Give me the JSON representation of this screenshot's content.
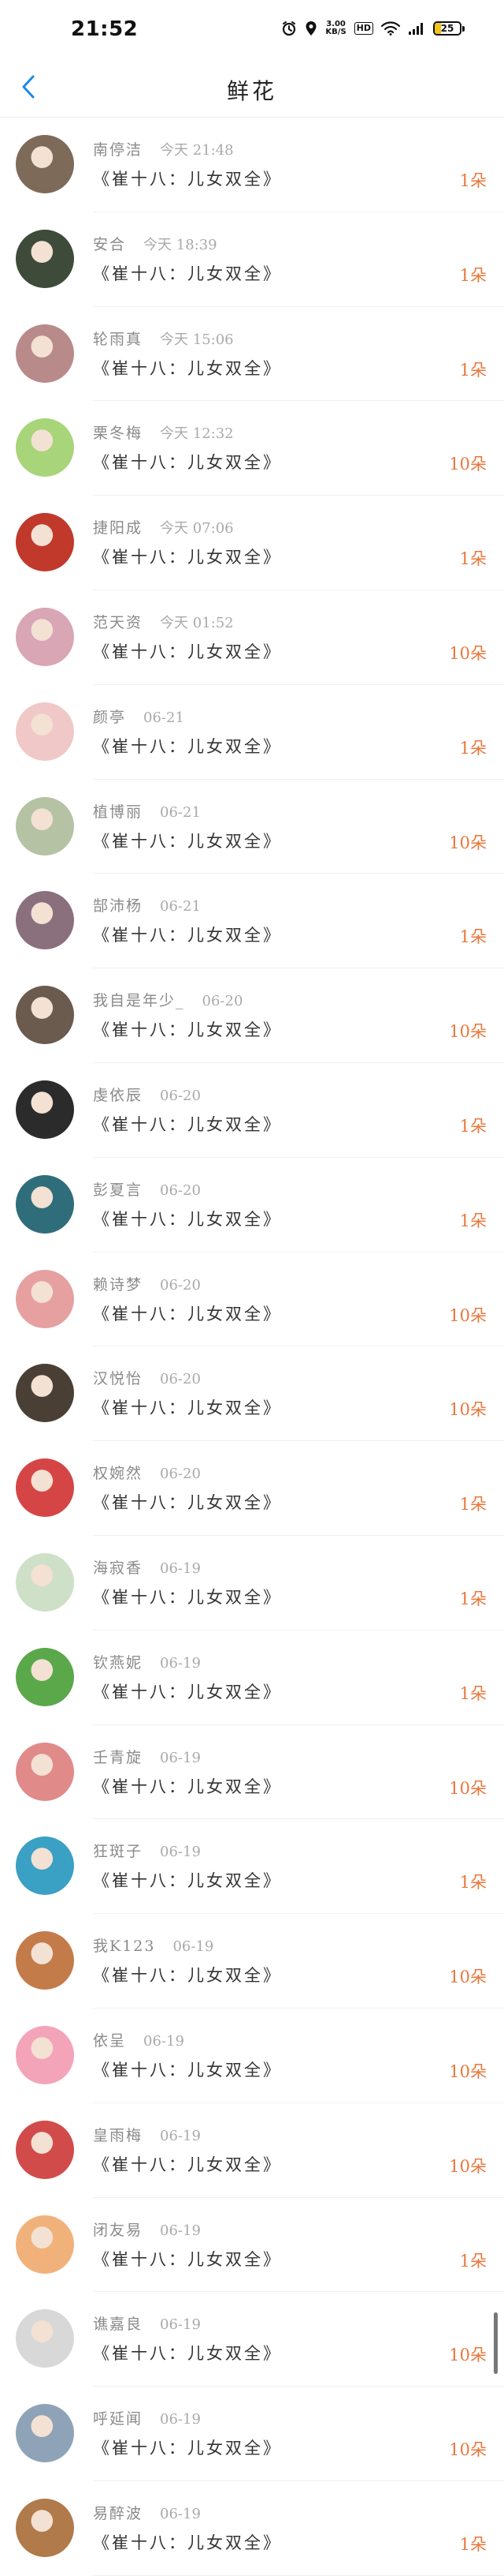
{
  "status_bar": {
    "time": "21:52",
    "net_speed_value": "3.00",
    "net_speed_unit": "KB/S",
    "hd_label": "HD",
    "battery_level": "25",
    "battery_fraction": 0.25,
    "battery_color": "#f2c31a"
  },
  "nav": {
    "back_icon": "chevron-left-icon",
    "title": "鲜花"
  },
  "colors": {
    "accent_blue": "#1e88e5",
    "count_orange": "#e8773b"
  },
  "items": [
    {
      "name": "南停洁",
      "time": "今天 21:48",
      "gift": "《崔十八：儿女双全》",
      "count": "1朵",
      "avatar_color": "#7d6a58"
    },
    {
      "name": "安合",
      "time": "今天 18:39",
      "gift": "《崔十八：儿女双全》",
      "count": "1朵",
      "avatar_color": "#3e4a3a"
    },
    {
      "name": "轮雨真",
      "time": "今天 15:06",
      "gift": "《崔十八：儿女双全》",
      "count": "1朵",
      "avatar_color": "#b98a8a"
    },
    {
      "name": "栗冬梅",
      "time": "今天 12:32",
      "gift": "《崔十八：儿女双全》",
      "count": "10朵",
      "avatar_color": "#a8d47a"
    },
    {
      "name": "捷阳成",
      "time": "今天 07:06",
      "gift": "《崔十八：儿女双全》",
      "count": "1朵",
      "avatar_color": "#c0392b"
    },
    {
      "name": "范天资",
      "time": "今天 01:52",
      "gift": "《崔十八：儿女双全》",
      "count": "10朵",
      "avatar_color": "#d9a6b5"
    },
    {
      "name": "颜亭",
      "time": "06-21",
      "gift": "《崔十八：儿女双全》",
      "count": "1朵",
      "avatar_color": "#f0c8c8"
    },
    {
      "name": "植博丽",
      "time": "06-21",
      "gift": "《崔十八：儿女双全》",
      "count": "10朵",
      "avatar_color": "#b5c2a3"
    },
    {
      "name": "郜沛杨",
      "time": "06-21",
      "gift": "《崔十八：儿女双全》",
      "count": "1朵",
      "avatar_color": "#8a6f7d"
    },
    {
      "name": "我自是年少_",
      "time": "06-20",
      "gift": "《崔十八：儿女双全》",
      "count": "10朵",
      "avatar_color": "#6b5a4e"
    },
    {
      "name": "虔依辰",
      "time": "06-20",
      "gift": "《崔十八：儿女双全》",
      "count": "1朵",
      "avatar_color": "#2b2b2b"
    },
    {
      "name": "彭夏言",
      "time": "06-20",
      "gift": "《崔十八：儿女双全》",
      "count": "1朵",
      "avatar_color": "#2f6d7a"
    },
    {
      "name": "赖诗梦",
      "time": "06-20",
      "gift": "《崔十八：儿女双全》",
      "count": "10朵",
      "avatar_color": "#e6a0a0"
    },
    {
      "name": "汉悦怡",
      "time": "06-20",
      "gift": "《崔十八：儿女双全》",
      "count": "10朵",
      "avatar_color": "#4a3f35"
    },
    {
      "name": "权婉然",
      "time": "06-20",
      "gift": "《崔十八：儿女双全》",
      "count": "1朵",
      "avatar_color": "#d64545"
    },
    {
      "name": "海寂香",
      "time": "06-19",
      "gift": "《崔十八：儿女双全》",
      "count": "1朵",
      "avatar_color": "#cfe0c8"
    },
    {
      "name": "钦燕妮",
      "time": "06-19",
      "gift": "《崔十八：儿女双全》",
      "count": "1朵",
      "avatar_color": "#5aa84a"
    },
    {
      "name": "壬青旋",
      "time": "06-19",
      "gift": "《崔十八：儿女双全》",
      "count": "10朵",
      "avatar_color": "#e08a8a"
    },
    {
      "name": "狂斑子",
      "time": "06-19",
      "gift": "《崔十八：儿女双全》",
      "count": "1朵",
      "avatar_color": "#3aa0c4"
    },
    {
      "name": "我K123",
      "time": "06-19",
      "gift": "《崔十八：儿女双全》",
      "count": "10朵",
      "avatar_color": "#c47b4a"
    },
    {
      "name": "依呈",
      "time": "06-19",
      "gift": "《崔十八：儿女双全》",
      "count": "10朵",
      "avatar_color": "#f4a4b8"
    },
    {
      "name": "皇雨梅",
      "time": "06-19",
      "gift": "《崔十八：儿女双全》",
      "count": "10朵",
      "avatar_color": "#d24b4b"
    },
    {
      "name": "闭友易",
      "time": "06-19",
      "gift": "《崔十八：儿女双全》",
      "count": "1朵",
      "avatar_color": "#f0b27a"
    },
    {
      "name": "谯嘉良",
      "time": "06-19",
      "gift": "《崔十八：儿女双全》",
      "count": "10朵",
      "avatar_color": "#d8d8d8"
    },
    {
      "name": "呼延闻",
      "time": "06-19",
      "gift": "《崔十八：儿女双全》",
      "count": "10朵",
      "avatar_color": "#8fa3b8"
    },
    {
      "name": "易醉波",
      "time": "06-19",
      "gift": "《崔十八：儿女双全》",
      "count": "1朵",
      "avatar_color": "#b07a4a"
    }
  ]
}
